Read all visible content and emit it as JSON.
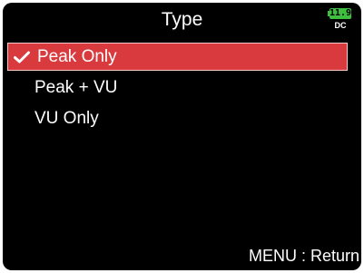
{
  "header": {
    "title": "Type",
    "battery": {
      "level": "11.9",
      "source": "DC"
    }
  },
  "menu": {
    "items": [
      {
        "label": "Peak Only",
        "selected": true
      },
      {
        "label": "Peak + VU",
        "selected": false
      },
      {
        "label": "VU Only",
        "selected": false
      }
    ]
  },
  "footer": {
    "hint": "MENU : Return"
  },
  "colors": {
    "background": "#000000",
    "highlight": "#d93a3e",
    "battery": "#3fbf3f",
    "text": "#ffffff"
  },
  "icons": {
    "selected_marker": "checkmark-icon",
    "battery": "battery-icon"
  }
}
